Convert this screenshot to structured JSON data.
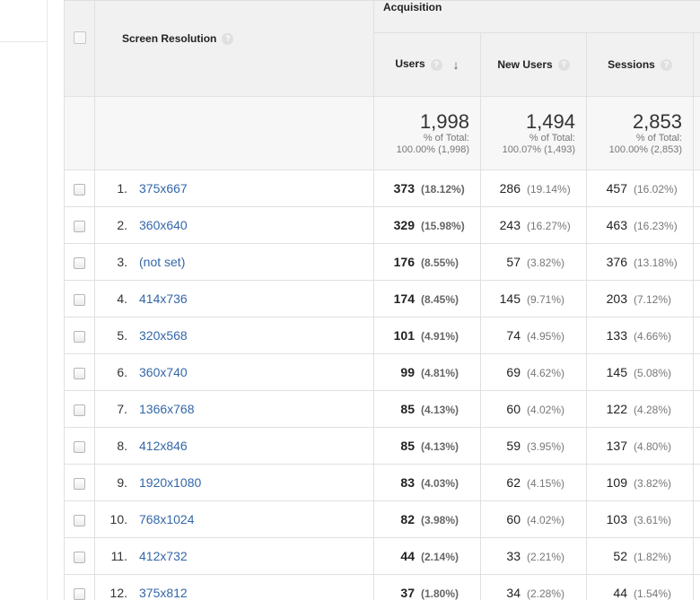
{
  "header": {
    "dimension": "Screen Resolution",
    "group": "Acquisition",
    "help_glyph": "?",
    "sort_glyph": "↓",
    "columns": [
      "Users",
      "New Users",
      "Sessions"
    ]
  },
  "totals": [
    {
      "value": "1,998",
      "label": "% of Total:",
      "detail": "100.00% (1,998)"
    },
    {
      "value": "1,494",
      "label": "% of Total:",
      "detail": "100.07% (1,493)"
    },
    {
      "value": "2,853",
      "label": "% of Total:",
      "detail": "100.00% (2,853)"
    }
  ],
  "rows": [
    {
      "index": "1.",
      "name": "375x667",
      "users": "373",
      "users_pct": "(18.12%)",
      "new_users": "286",
      "new_users_pct": "(19.14%)",
      "sessions": "457",
      "sessions_pct": "(16.02%)"
    },
    {
      "index": "2.",
      "name": "360x640",
      "users": "329",
      "users_pct": "(15.98%)",
      "new_users": "243",
      "new_users_pct": "(16.27%)",
      "sessions": "463",
      "sessions_pct": "(16.23%)"
    },
    {
      "index": "3.",
      "name": "(not set)",
      "users": "176",
      "users_pct": "(8.55%)",
      "new_users": "57",
      "new_users_pct": "(3.82%)",
      "sessions": "376",
      "sessions_pct": "(13.18%)"
    },
    {
      "index": "4.",
      "name": "414x736",
      "users": "174",
      "users_pct": "(8.45%)",
      "new_users": "145",
      "new_users_pct": "(9.71%)",
      "sessions": "203",
      "sessions_pct": "(7.12%)"
    },
    {
      "index": "5.",
      "name": "320x568",
      "users": "101",
      "users_pct": "(4.91%)",
      "new_users": "74",
      "new_users_pct": "(4.95%)",
      "sessions": "133",
      "sessions_pct": "(4.66%)"
    },
    {
      "index": "6.",
      "name": "360x740",
      "users": "99",
      "users_pct": "(4.81%)",
      "new_users": "69",
      "new_users_pct": "(4.62%)",
      "sessions": "145",
      "sessions_pct": "(5.08%)"
    },
    {
      "index": "7.",
      "name": "1366x768",
      "users": "85",
      "users_pct": "(4.13%)",
      "new_users": "60",
      "new_users_pct": "(4.02%)",
      "sessions": "122",
      "sessions_pct": "(4.28%)"
    },
    {
      "index": "8.",
      "name": "412x846",
      "users": "85",
      "users_pct": "(4.13%)",
      "new_users": "59",
      "new_users_pct": "(3.95%)",
      "sessions": "137",
      "sessions_pct": "(4.80%)"
    },
    {
      "index": "9.",
      "name": "1920x1080",
      "users": "83",
      "users_pct": "(4.03%)",
      "new_users": "62",
      "new_users_pct": "(4.15%)",
      "sessions": "109",
      "sessions_pct": "(3.82%)"
    },
    {
      "index": "10.",
      "name": "768x1024",
      "users": "82",
      "users_pct": "(3.98%)",
      "new_users": "60",
      "new_users_pct": "(4.02%)",
      "sessions": "103",
      "sessions_pct": "(3.61%)"
    },
    {
      "index": "11.",
      "name": "412x732",
      "users": "44",
      "users_pct": "(2.14%)",
      "new_users": "33",
      "new_users_pct": "(2.21%)",
      "sessions": "52",
      "sessions_pct": "(1.82%)"
    },
    {
      "index": "12.",
      "name": "375x812",
      "users": "37",
      "users_pct": "(1.80%)",
      "new_users": "34",
      "new_users_pct": "(2.28%)",
      "sessions": "44",
      "sessions_pct": "(1.54%)"
    }
  ],
  "colors": {
    "link": "#3367a8",
    "header_bg": "#f1f1f1",
    "totals_bg": "#f7f7f7",
    "border": "#e0e0e0"
  }
}
